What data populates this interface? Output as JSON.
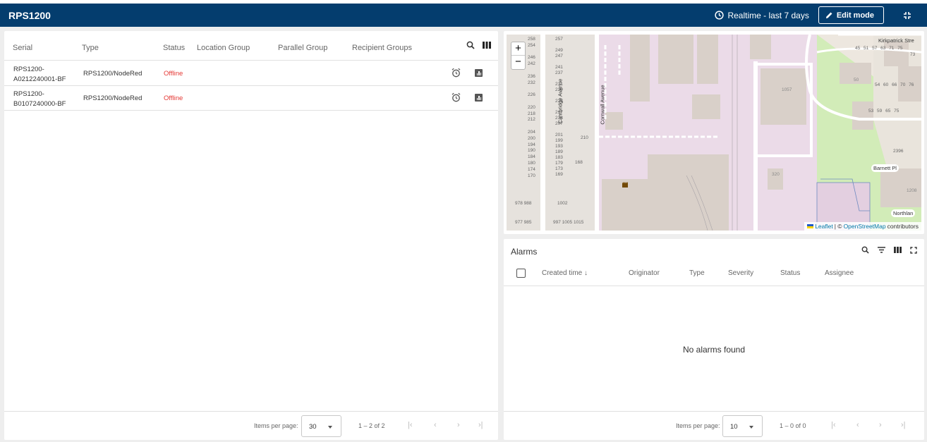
{
  "header": {
    "title": "RPS1200",
    "timewindow": "Realtime - last 7 days",
    "edit_mode": "Edit mode"
  },
  "devices": {
    "columns": [
      "Serial",
      "Type",
      "Status",
      "Location Group",
      "Parallel Group",
      "Recipient Groups"
    ],
    "rows": [
      {
        "serial_line1": "RPS1200-",
        "serial_line2": "A0212240001-BF",
        "type": "RPS1200/NodeRed",
        "status": "Offline"
      },
      {
        "serial_line1": "RPS1200-",
        "serial_line2": "B0107240000-BF",
        "type": "RPS1200/NodeRed",
        "status": "Offline"
      }
    ],
    "pager": {
      "items_per_page_label": "Items per page:",
      "page_size": "30",
      "range": "1 – 2 of 2"
    }
  },
  "map": {
    "streets": [
      "Cambridge Avenue",
      "Cornwall Avenue",
      "Kirkpatrick Stre",
      "Barnett Pl",
      "Northlan"
    ],
    "numbers_left": [
      "258",
      "254",
      "246",
      "242",
      "236",
      "232",
      "226",
      "220",
      "218",
      "212",
      "204",
      "200",
      "194",
      "190",
      "184",
      "180",
      "174",
      "170",
      "978",
      "988",
      "977",
      "985"
    ],
    "numbers_mid": [
      "257",
      "249",
      "247",
      "241",
      "237",
      "231",
      "229",
      "223",
      "217",
      "213",
      "207",
      "201",
      "199",
      "193",
      "189",
      "183",
      "179",
      "173",
      "169",
      "1002",
      "997",
      "1005",
      "1015"
    ],
    "numbers_right": [
      "210",
      "168",
      "1057",
      "320",
      "2396",
      "1208"
    ],
    "numbers_topright": [
      "45",
      "51",
      "57",
      "63",
      "71",
      "75",
      "73",
      "50",
      "54",
      "60",
      "66",
      "70",
      "76",
      "53",
      "59",
      "65",
      "75"
    ],
    "zoom_in": "+",
    "zoom_out": "−",
    "attribution": {
      "leaflet": "Leaflet",
      "sep": " | © ",
      "osm": "OpenStreetMap",
      "suffix": " contributors"
    },
    "colors": {
      "industrial": "#ebdbe8",
      "building": "#d9d0c9",
      "park": "#cdebb0",
      "road": "#ffffff"
    }
  },
  "alarms": {
    "title": "Alarms",
    "columns": [
      "Created time",
      "Originator",
      "Type",
      "Severity",
      "Status",
      "Assignee"
    ],
    "sort_arrow": "↓",
    "empty": "No alarms found",
    "pager": {
      "items_per_page_label": "Items per page:",
      "page_size": "10",
      "range": "1 – 0 of 0"
    }
  }
}
